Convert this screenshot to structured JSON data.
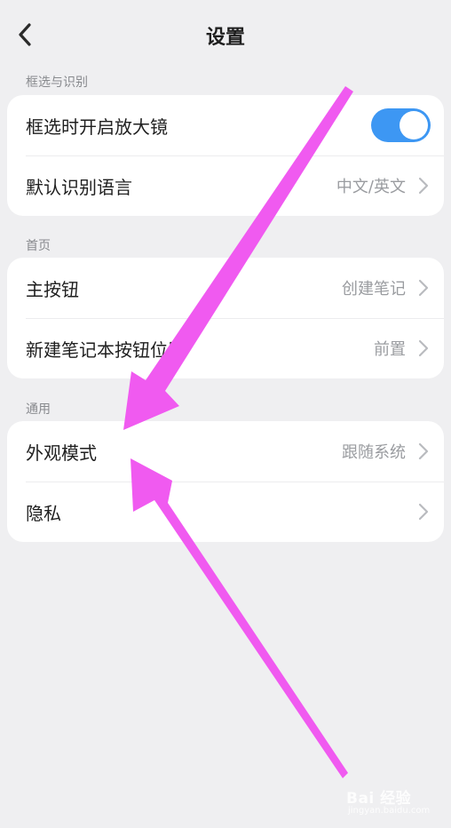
{
  "header": {
    "title": "设置",
    "back_icon": "chevron-left-icon"
  },
  "sections": [
    {
      "label": "框选与识别",
      "rows": [
        {
          "label": "框选时开启放大镜",
          "toggle_on": true
        },
        {
          "label": "默认识别语言",
          "value": "中文/英文"
        }
      ]
    },
    {
      "label": "首页",
      "rows": [
        {
          "label": "主按钮",
          "value": "创建笔记"
        },
        {
          "label": "新建笔记本按钮位置",
          "value": "前置"
        }
      ]
    },
    {
      "label": "通用",
      "rows": [
        {
          "label": "外观模式",
          "value": "跟随系统"
        },
        {
          "label": "隐私",
          "value": ""
        }
      ]
    }
  ],
  "colors": {
    "accent": "#3d97f3",
    "background": "#efeff1",
    "annotation_arrow": "#f05af0"
  },
  "watermark": {
    "main": "Bai 经验",
    "sub": "jingyan.baidu.com"
  }
}
